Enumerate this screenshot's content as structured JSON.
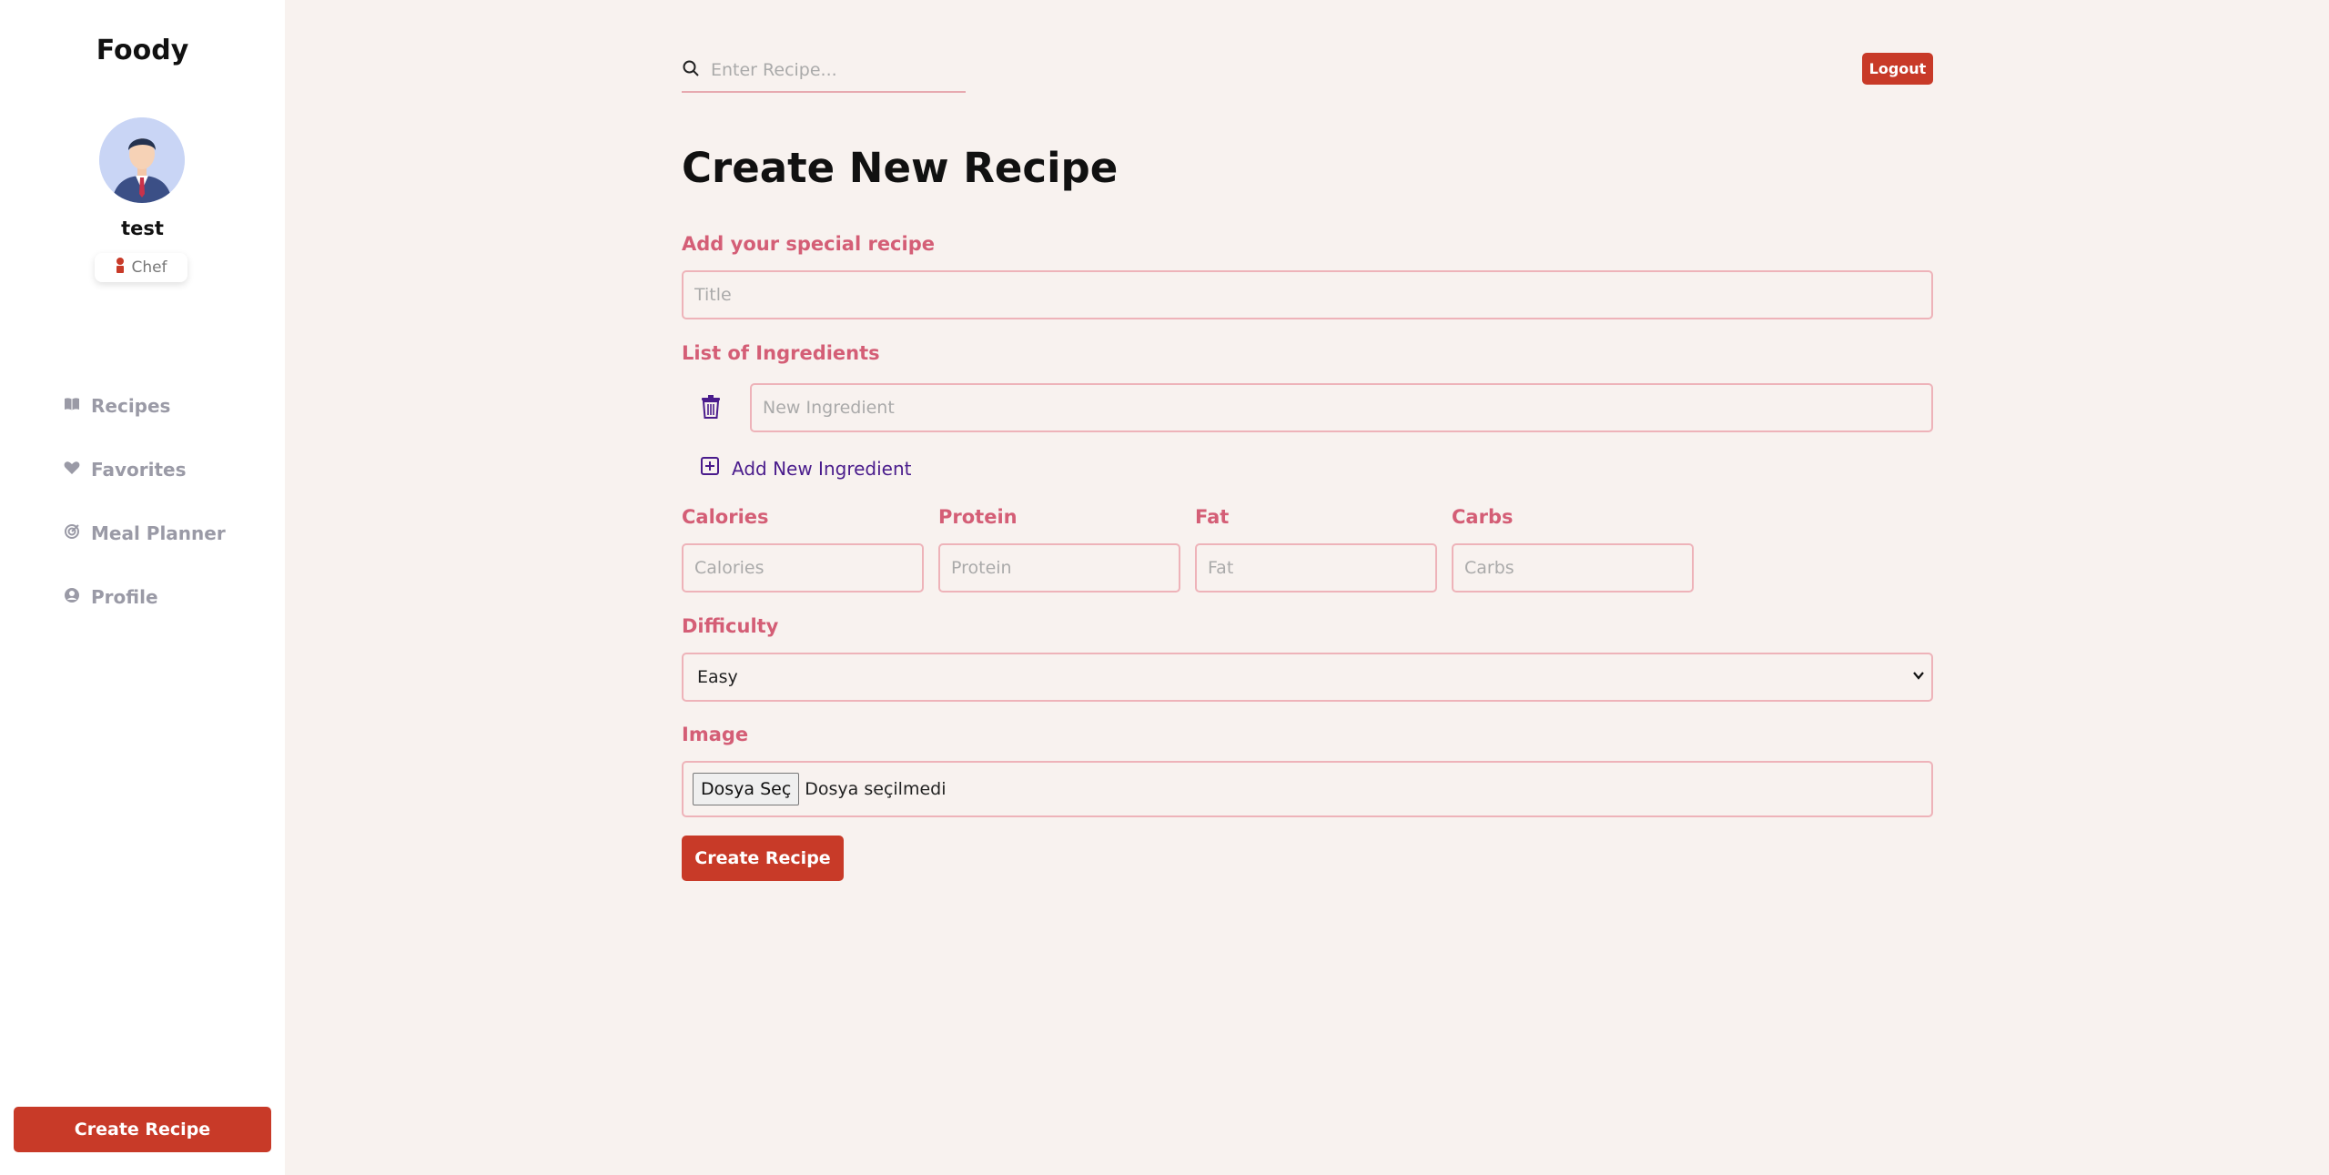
{
  "sidebar": {
    "brand": "Foody",
    "user": {
      "name": "test",
      "role": "Chef"
    },
    "nav": [
      {
        "label": "Recipes",
        "icon": "book-icon"
      },
      {
        "label": "Favorites",
        "icon": "heart-icon"
      },
      {
        "label": "Meal Planner",
        "icon": "planner-icon"
      },
      {
        "label": "Profile",
        "icon": "user-circle-icon"
      }
    ],
    "create_label": "Create Recipe"
  },
  "header": {
    "search_placeholder": "Enter Recipe...",
    "logout_label": "Logout"
  },
  "form": {
    "title": "Create New Recipe",
    "recipe_label": "Add your special recipe",
    "title_placeholder": "Title",
    "ingredients_label": "List of Ingredients",
    "ingredient_placeholder": "New Ingredient",
    "add_ingredient_label": "Add New Ingredient",
    "nutrition": [
      {
        "label": "Calories",
        "placeholder": "Calories"
      },
      {
        "label": "Protein",
        "placeholder": "Protein"
      },
      {
        "label": "Fat",
        "placeholder": "Fat"
      },
      {
        "label": "Carbs",
        "placeholder": "Carbs"
      }
    ],
    "difficulty_label": "Difficulty",
    "difficulty_value": "Easy",
    "image_label": "Image",
    "file_button": "Dosya Seç",
    "file_status": "Dosya seçilmedi",
    "submit_label": "Create Recipe"
  },
  "colors": {
    "accent": "#c83a28",
    "label": "#d45e76",
    "field_border": "#eeb3b9",
    "background": "#f8f2ef",
    "link": "#4a1c8c"
  }
}
